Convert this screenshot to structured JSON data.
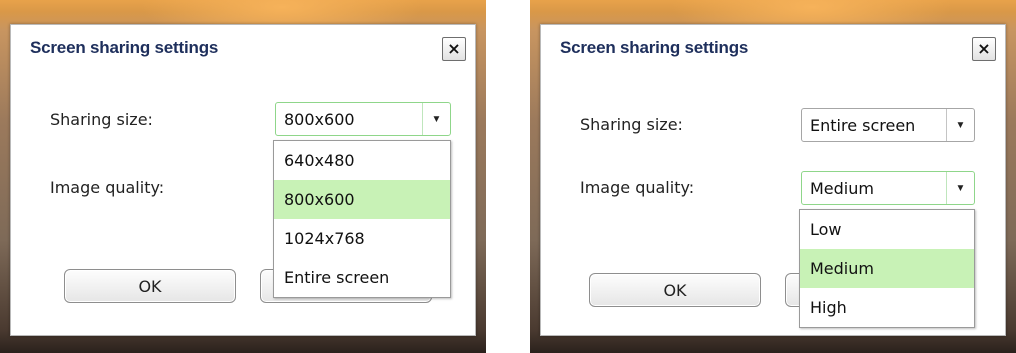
{
  "left": {
    "title": "Screen sharing settings",
    "close_label": "×",
    "sharing_size": {
      "label": "Sharing size:",
      "value": "800x600"
    },
    "image_quality": {
      "label": "Image quality:"
    },
    "ok_label": "OK",
    "dropdown_options": [
      "640x480",
      "800x600",
      "1024x768",
      "Entire screen"
    ],
    "selected_option": "800x600"
  },
  "right": {
    "title": "Screen sharing settings",
    "close_label": "×",
    "sharing_size": {
      "label": "Sharing size:",
      "value": "Entire screen"
    },
    "image_quality": {
      "label": "Image quality:",
      "value": "Medium"
    },
    "ok_label": "OK",
    "dropdown_options": [
      "Low",
      "Medium",
      "High"
    ],
    "selected_option": "Medium"
  },
  "colors": {
    "title_text": "#1e2f5c",
    "selected_option_bg": "#c8f2b6",
    "focused_border": "#8fd68a"
  },
  "icons": {
    "dropdown_arrow": "triangle-down",
    "close": "x-mark"
  }
}
